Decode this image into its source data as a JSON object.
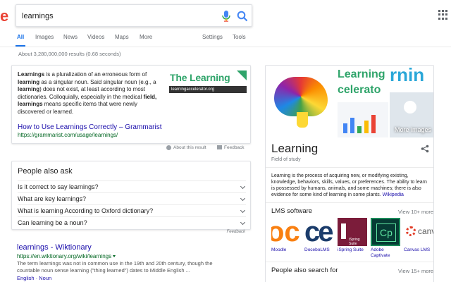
{
  "search": {
    "logo_fragment": "e",
    "query": "learnings"
  },
  "tabs": {
    "all": "All",
    "images": "Images",
    "news": "News",
    "videos": "Videos",
    "maps": "Maps",
    "more": "More",
    "settings": "Settings",
    "tools": "Tools"
  },
  "result_stats": "About 3,280,000,000 results (0.68 seconds)",
  "snippet": {
    "term1": "Learnings",
    "text1": " is a pluralization of an erroneous form of ",
    "term2": "learning",
    "text2": " as a singular noun. Said singular noun (e.g., a ",
    "term3": "learning",
    "text3": ") does not exist, at least according to most dictionaries. Colloquially, especially in the medical ",
    "term4": "field, learnings",
    "text4": " means specific items that were newly discovered or learned.",
    "image_brand": "The Learning",
    "image_url": "learningaccelerator.org",
    "link_title": "How to Use Learnings Correctly – Grammarist",
    "link_url": "https://grammarist.com/usage/learnings/",
    "about": "About this result",
    "feedback": "Feedback"
  },
  "people_also_ask": {
    "title": "People also ask",
    "questions": [
      "Is it correct to say learnings?",
      "What are key learnings?",
      "What is learning According to Oxford dictionary?",
      "Can learning be a noun?"
    ],
    "feedback": "Feedback"
  },
  "wiki_result": {
    "title": "learnings - Wiktionary",
    "url": "https://en.wiktionary.org/wiki/learnings",
    "text": "The term learnings was not in common use in the 19th and 20th century, though the countable noun sense learning (\"thing learned\") dates to Middle English ...",
    "links": "English · Noun"
  },
  "knowledge_panel": {
    "img_text_1": "Learning",
    "img_text_2": "celerato",
    "img_text_3": "rnin",
    "more_images": "More images",
    "title": "Learning",
    "subtitle": "Field of study",
    "description": "Learning is the process of acquiring new, or modifying existing, knowledge, behaviors, skills, values, or preferences. The ability to learn is possessed by humans, animals, and some machines; there is also evidence for some kind of learning in some plants. ",
    "description_link": "Wikipedia",
    "lms_title": "LMS software",
    "lms_view_more": "View 10+ more",
    "lms_items": [
      {
        "name": "Moodle",
        "logo_text": "oce"
      },
      {
        "name": "DoceboLMS",
        "logo_text": "ce"
      },
      {
        "name": "iSpring Suite",
        "logo_text": "iSpring Suite"
      },
      {
        "name": "Adobe Captivate",
        "logo_text": "Cp"
      },
      {
        "name": "Canvas LMS",
        "logo_text": "canva"
      }
    ],
    "psf_title": "People also search for",
    "psf_view_more": "View 15+ more"
  },
  "colors": {
    "link": "#1a0dab",
    "url_green": "#006621",
    "accent_blue": "#1a73e8",
    "brand_green": "#2fa46a"
  }
}
